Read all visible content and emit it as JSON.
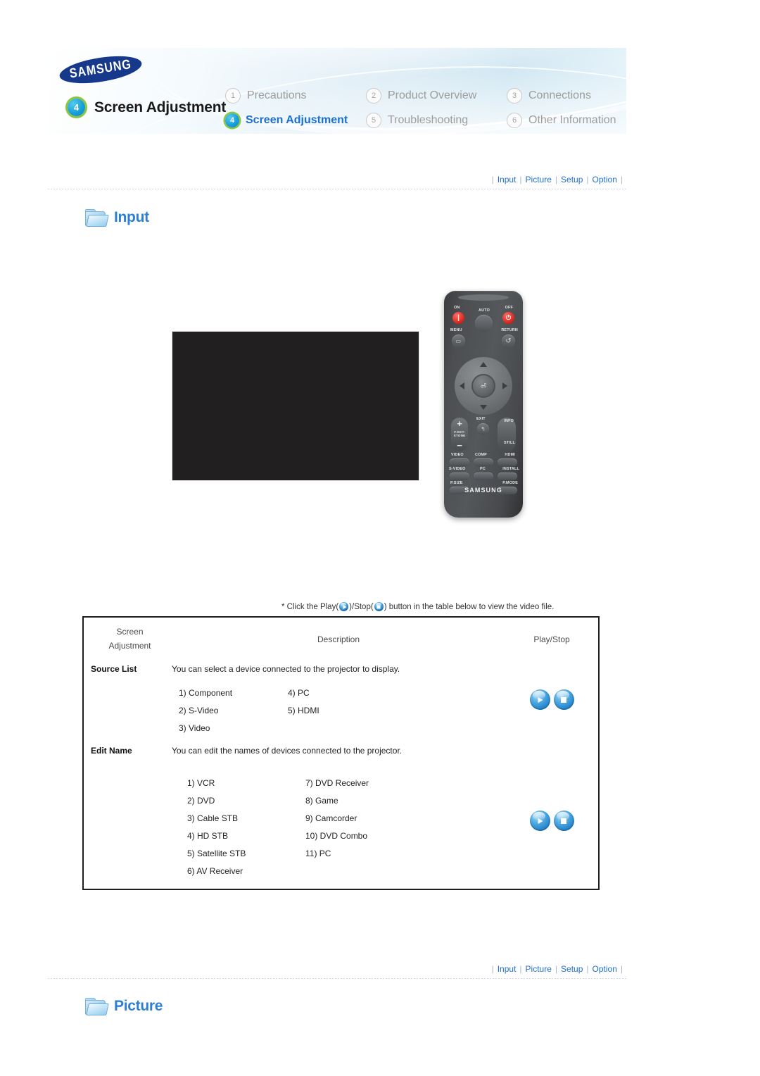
{
  "brand": "SAMSUNG",
  "header": {
    "section_badge": "4",
    "section_title": "Screen Adjustment",
    "menu": [
      {
        "num": "1",
        "label": "Precautions",
        "selected": false
      },
      {
        "num": "2",
        "label": "Product Overview",
        "selected": false
      },
      {
        "num": "3",
        "label": "Connections",
        "selected": false
      },
      {
        "num": "4",
        "label": "Screen Adjustment",
        "selected": true
      },
      {
        "num": "5",
        "label": "Troubleshooting",
        "selected": false
      },
      {
        "num": "6",
        "label": "Other Information",
        "selected": false
      }
    ]
  },
  "navlinks": {
    "items": [
      "Input",
      "Picture",
      "Setup",
      "Option"
    ],
    "separator": "|"
  },
  "sections": {
    "input_heading": "Input",
    "picture_heading": "Picture"
  },
  "remote": {
    "labels": {
      "on": "ON",
      "auto": "AUTO",
      "off": "OFF",
      "menu": "MENU",
      "return": "RETURN",
      "keystone": "V-KEY-\nSTONE",
      "exit": "EXIT",
      "info": "INFO",
      "still": "STILL",
      "video": "VIDEO",
      "comp": "COMP",
      "hdmi": "HDMI",
      "svideo": "S-VIDEO",
      "pc": "PC",
      "install": "INSTALL",
      "psize": "P.SIZE",
      "pmode": "P.MODE",
      "brand": "SAMSUNG"
    }
  },
  "note": {
    "prefix": "* Click the Play(",
    "middle": ")/Stop(",
    "suffix": ") button in the table below to view the video file."
  },
  "table": {
    "headers": {
      "col1_line1": "Screen",
      "col1_line2": "Adjustment",
      "col2": "Description",
      "col3": "Play/Stop"
    },
    "rows": [
      {
        "name": "Source List",
        "description": "You can select a device connected to the projector to display.",
        "items_left": [
          "1) Component",
          "2) S-Video",
          "3) Video"
        ],
        "items_right": [
          "4) PC",
          "5) HDMI"
        ],
        "play_label": "Play",
        "stop_label": "Stop"
      },
      {
        "name": "Edit Name",
        "description": "You can edit the names of devices connected to the projector.",
        "items_left": [
          "1) VCR",
          "2) DVD",
          "3) Cable STB",
          "4) HD STB",
          "5) Satellite STB",
          "6) AV Receiver"
        ],
        "items_right": [
          "7) DVD Receiver",
          "8) Game",
          "9) Camcorder",
          "10) DVD Combo",
          "11) PC"
        ],
        "play_label": "Play",
        "stop_label": "Stop"
      }
    ]
  },
  "colors": {
    "link_blue": "#1f6fcf",
    "heading_blue": "#2c7fd4",
    "badge_green_ring": "#8cc63f",
    "samsung_navy": "#17398c",
    "video_black": "#211f20"
  }
}
